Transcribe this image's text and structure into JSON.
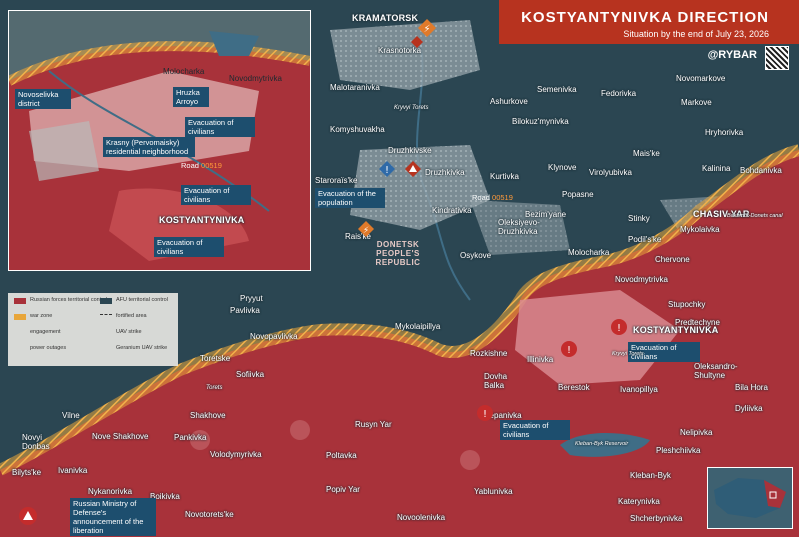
{
  "header": {
    "title": "KOSTYANTYNIVKA DIRECTION",
    "subtitle": "Situation by the end of July 23, 2026",
    "brand": "@RYBAR"
  },
  "colors": {
    "russian": "#a8323a",
    "gray_zone": "#e8a63a",
    "afu": "#2b4652",
    "town": "#9aa7ad",
    "accent": "#b7331f",
    "label_blue": "#1d4e6e"
  },
  "legend": {
    "russian_forces": "Russian forces territorial control",
    "afu": "AFU territorial control",
    "war_zone": "war zone",
    "fortified": "fortified area",
    "engagement": "engagement",
    "uav": "UAV strike",
    "power": "power outages",
    "geranium": "Geranium UAV strike"
  },
  "inset": {
    "labels": [
      "Molocharka",
      "Novodmytrivka",
      "Novoselivka district",
      "Hruzka Arroyo",
      "Krasny (Pervomaisky) residential neighborhood",
      "KOSTYANTYNIVKA"
    ],
    "road": "Road",
    "road_num": "00519",
    "evac": [
      "Evacuation of civilians",
      "Evacuation of civilians",
      "Evacuation of civilians"
    ]
  },
  "main": {
    "cities": {
      "kramatorsk": "KRAMATORSK",
      "kostyantynivka": "KOSTYANTYNIVKA",
      "chasiv_yar": "CHASIV YAR",
      "druzhkivka": "Druzhkivka"
    },
    "places": [
      "Krasnotorka",
      "Malotaranivka",
      "Ashurkove",
      "Semenivka",
      "Fedorivka",
      "Novomarkove",
      "Markove",
      "Hryhorivka",
      "Komyshuvakha",
      "Bilokuz'mynivka",
      "Mais'ke",
      "Kalinina",
      "Bohdanivka",
      "Druzhkivske",
      "Kurtivka",
      "Klynove",
      "Virolyubivka",
      "Staroraïs'ke",
      "Popasne",
      "Stinky",
      "Kindrativka",
      "Bezim'yane",
      "Mykolaivka",
      "Rais'ke",
      "Oleksiyevo-Druzhkivka",
      "Podil's'ke",
      "Chervone",
      "Osykove",
      "Molocharka",
      "Novodmytrivka",
      "Stupochky",
      "Predtechyne",
      "Pryyut",
      "Pavlivka",
      "Novopavlivka",
      "Mykolaipillya",
      "Toretskе",
      "Sofiivka",
      "Rozkishne",
      "Illinivka",
      "Dovha Balka",
      "Berestok",
      "Ivanopillya",
      "Oleksandro-Shultyne",
      "Bila Hora",
      "Dyliivka",
      "Vilne",
      "Nove Shakhove",
      "Shakhove",
      "Stepanivka",
      "Novyi Donbas",
      "Pankivka",
      "Volodymyrivka",
      "Rusyn Yar",
      "Nelipivka",
      "Pleshchiivka",
      "Ivanivka",
      "Poltavka",
      "Kleban-Byk",
      "Nykanorivka",
      "Boikivka",
      "Popiv Yar",
      "Katerynivka",
      "Bilyts'ke",
      "Novotorets'ke",
      "Yablunivka",
      "Shcherbynivka",
      "Novoolenivka"
    ],
    "road": "Road",
    "road_num": "00519",
    "dnr": "DONETSK PEOPLE'S REPUBLIC",
    "evac": [
      "Evacuation of the population",
      "Evacuation of civilians",
      "Evacuation of civilians"
    ],
    "ministry": "Russian Ministry of Defense's announcement of the liberation",
    "small": [
      "Hruzka Arroyo",
      "Kryvyi Torets",
      "Torets",
      "Kleban-Byk Reservoir",
      "Bakhmut-Donets canal",
      "Kryvyi Torets"
    ]
  }
}
